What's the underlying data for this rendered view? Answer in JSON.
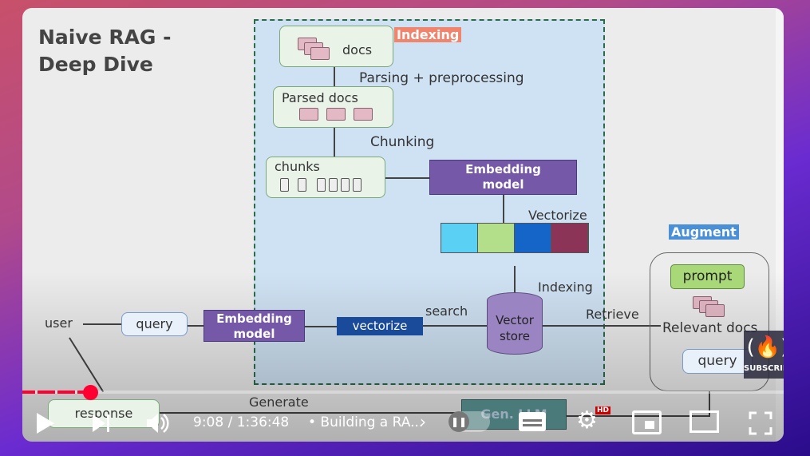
{
  "slide": {
    "title_line1": "Naive RAG -",
    "title_line2": "Deep Dive",
    "indexing_tag": "Indexing",
    "docs": "docs",
    "parsing": "Parsing + preprocessing",
    "parsed_docs": "Parsed docs",
    "chunking": "Chunking",
    "chunks": "chunks",
    "embedding_model_1": "Embedding",
    "embedding_model_2": "model",
    "vectorize": "Vectorize",
    "indexing": "Indexing",
    "vector_store_1": "Vector",
    "vector_store_2": "store",
    "search": "search",
    "retrieve": "Retrieve",
    "augment_tag": "Augment",
    "prompt": "prompt",
    "relevant_docs": "Relevant docs",
    "query_aug": "query",
    "user": "user",
    "query": "query",
    "q_embedding_1": "Embedding",
    "q_embedding_2": "model",
    "q_vectorize": "vectorize",
    "generate": "Generate",
    "response": "response",
    "gen_llm": "Gen. LLM",
    "vector_colors": [
      "#5bd0f5",
      "#b4df8a",
      "#1565c8",
      "#8c3358"
    ]
  },
  "player": {
    "time": "9:08 / 1:36:48",
    "chapter": "• Building a RA...",
    "hd_badge": "HD",
    "subscribe": "SUBSCRIBE",
    "progress_percent": 9.4,
    "accent": "#ff0033"
  }
}
